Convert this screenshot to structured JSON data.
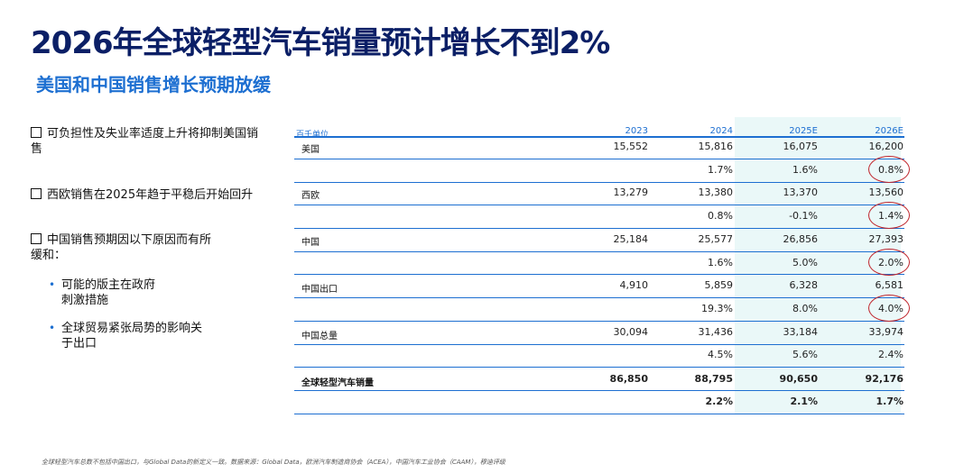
{
  "title": "2026年全球轻型汽车销量预计增长不到2%",
  "subtitle": "美国和中国销售增长预期放缓",
  "bullets": {
    "b1": "可负担性及失业率适度上升将抑制美国销售",
    "b2": "西欧销售在2025年趋于平稳后开始回升",
    "b3": "中国销售预期因以下原因而有所缓和：",
    "sub1": "可能的版主在政府刺激措施",
    "sub2": "全球贸易紧张局势的影响关于出口"
  },
  "table": {
    "unit": "百千单位",
    "headers": [
      "2023",
      "2024",
      "2025E",
      "2026E"
    ],
    "rows": [
      {
        "label": "美国",
        "values": [
          "15,552",
          "15,816",
          "16,075",
          "16,200"
        ],
        "growth": [
          "",
          "1.7%",
          "1.6%",
          "0.8%"
        ]
      },
      {
        "label": "西欧",
        "values": [
          "13,279",
          "13,380",
          "13,370",
          "13,560"
        ],
        "growth": [
          "",
          "0.8%",
          "-0.1%",
          "1.4%"
        ]
      },
      {
        "label": "中国",
        "values": [
          "25,184",
          "25,577",
          "26,856",
          "27,393"
        ],
        "growth": [
          "",
          "1.6%",
          "5.0%",
          "2.0%"
        ]
      },
      {
        "label": "中国出口",
        "values": [
          "4,910",
          "5,859",
          "6,328",
          "6,581"
        ],
        "growth": [
          "",
          "19.3%",
          "8.0%",
          "4.0%"
        ]
      },
      {
        "label": "中国总量",
        "values": [
          "30,094",
          "31,436",
          "33,184",
          "33,974"
        ],
        "growth": [
          "",
          "4.5%",
          "5.6%",
          "2.4%"
        ]
      },
      {
        "label": "全球轻型汽车销量",
        "values": [
          "86,850",
          "88,795",
          "90,650",
          "92,176"
        ],
        "growth": [
          "",
          "2.2%",
          "2.1%",
          "1.7%"
        ]
      }
    ]
  },
  "footer": "全球轻型汽车总数不包括中国出口，与Global Data的新定义一致。数据来源：Global Data，欧洲汽车制造商协会（ACEA），中国汽车工业协会（CAAM），穆迪评级"
}
